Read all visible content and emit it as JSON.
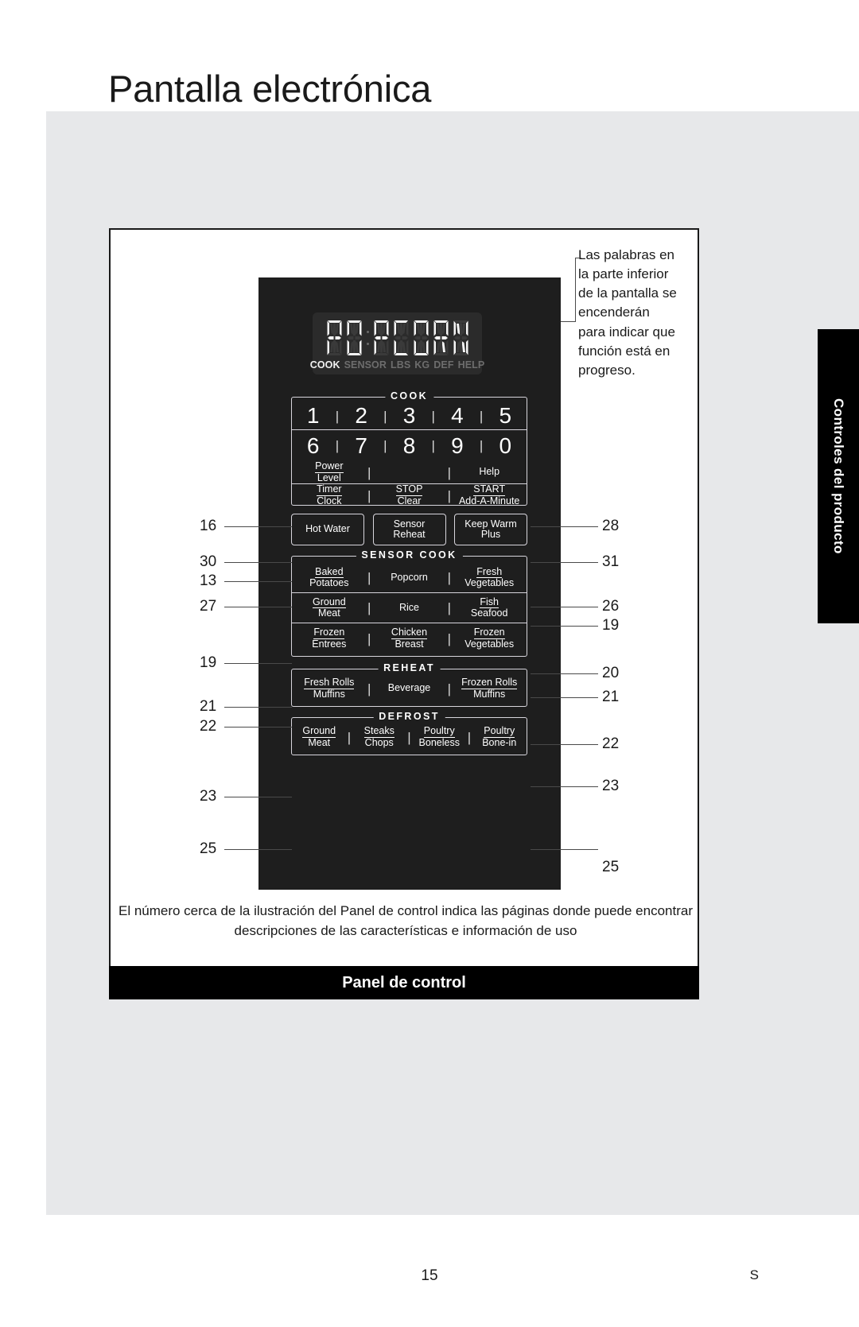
{
  "page": {
    "title": "Pantalla electrónica",
    "footer_page_number": "15",
    "footer_marker": "S",
    "side_tab_label": "Controles del producto"
  },
  "figure": {
    "callout_note": "Las palabras en la parte inferior de la pantalla se encenderán para indicar que función está en progreso.",
    "caption": "El número cerca de la ilustración del Panel de control indica las páginas donde puede encontrar descripciones de las características e información de uso",
    "bar_title": "Panel de control"
  },
  "display": {
    "text": "POPCORN",
    "characters": [
      "P",
      "O",
      "P",
      "C",
      "O",
      "R",
      "N"
    ],
    "indicators": [
      {
        "label": "COOK",
        "active": true
      },
      {
        "label": "SENSOR",
        "active": false
      },
      {
        "label": "LBS",
        "active": false
      },
      {
        "label": "KG",
        "active": false
      },
      {
        "label": "DEF",
        "active": false
      },
      {
        "label": "HELP",
        "active": false
      }
    ]
  },
  "panel": {
    "cook": {
      "title": "COOK",
      "row1": [
        "1",
        "2",
        "3",
        "4",
        "5"
      ],
      "row2": [
        "6",
        "7",
        "8",
        "9",
        "0"
      ],
      "row3": [
        {
          "top": "Power",
          "bot": "Level"
        },
        {
          "top": "",
          "bot": ""
        },
        {
          "top": "",
          "bot": "Help"
        }
      ],
      "row4": [
        {
          "top": "Timer",
          "bot": "Clock"
        },
        {
          "top": "STOP",
          "bot": "Clear"
        },
        {
          "top": "START",
          "bot": "Add-A-Minute"
        }
      ]
    },
    "action_buttons": [
      {
        "top": "Hot Water",
        "bot": ""
      },
      {
        "top": "Sensor",
        "bot": "Reheat"
      },
      {
        "top": "Keep Warm",
        "bot": "Plus"
      }
    ],
    "sensor_cook": {
      "title": "SENSOR COOK",
      "rows": [
        [
          {
            "top": "Baked",
            "bot": "Potatoes"
          },
          {
            "top": "",
            "bot": "Popcorn"
          },
          {
            "top": "Fresh",
            "bot": "Vegetables"
          }
        ],
        [
          {
            "top": "Ground",
            "bot": "Meat"
          },
          {
            "top": "",
            "bot": "Rice"
          },
          {
            "top": "Fish",
            "bot": "Seafood"
          }
        ],
        [
          {
            "top": "Frozen",
            "bot": "Entrees"
          },
          {
            "top": "Chicken",
            "bot": "Breast"
          },
          {
            "top": "Frozen",
            "bot": "Vegetables"
          }
        ]
      ]
    },
    "reheat": {
      "title": "REHEAT",
      "rows": [
        [
          {
            "top": "Fresh Rolls",
            "bot": "Muffins"
          },
          {
            "top": "",
            "bot": "Beverage"
          },
          {
            "top": "Frozen Rolls",
            "bot": "Muffins"
          }
        ]
      ]
    },
    "defrost": {
      "title": "DEFROST",
      "rows": [
        [
          {
            "top": "Ground",
            "bot": "Meat"
          },
          {
            "top": "Steaks",
            "bot": "Chops"
          },
          {
            "top": "Poultry",
            "bot": "Boneless"
          },
          {
            "top": "Poultry",
            "bot": "Bone-in"
          }
        ]
      ]
    }
  },
  "callout_numbers": {
    "left": [
      "16",
      "30",
      "13",
      "27",
      "19",
      "21",
      "22",
      "23",
      "25"
    ],
    "right": [
      "28",
      "31",
      "26",
      "19",
      "20",
      "21",
      "22",
      "23",
      "25"
    ]
  },
  "colors": {
    "panel_dark": "#1e1e1e",
    "display_bg": "#2b2b2b",
    "line": "#d8d6dd",
    "band": "#e7e8ea",
    "accent_black": "#000000"
  }
}
